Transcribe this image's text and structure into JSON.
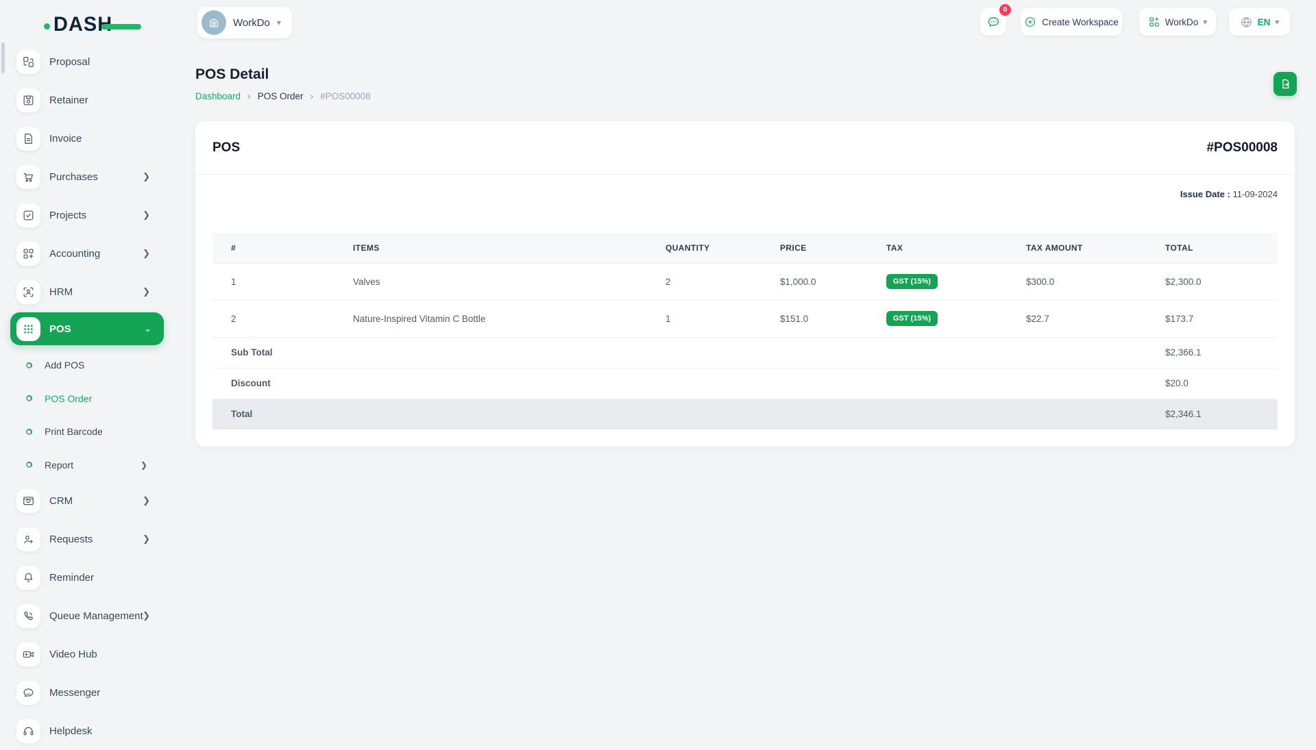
{
  "brand": {
    "logo": "DASH"
  },
  "topbar": {
    "workspace_name": "WorkDo",
    "chat_badge": "0",
    "create_workspace_label": "Create Workspace",
    "workspace_dropdown_label": "WorkDo",
    "language": "EN"
  },
  "page": {
    "title": "POS Detail",
    "breadcrumb": {
      "home": "Dashboard",
      "section": "POS Order",
      "current": "#POS00008"
    }
  },
  "sidebar": {
    "items": [
      {
        "label": "Proposal"
      },
      {
        "label": "Retainer"
      },
      {
        "label": "Invoice"
      },
      {
        "label": "Purchases"
      },
      {
        "label": "Projects"
      },
      {
        "label": "Accounting"
      },
      {
        "label": "HRM"
      },
      {
        "label": "CRM"
      },
      {
        "label": "Requests"
      },
      {
        "label": "Reminder"
      },
      {
        "label": "Queue Management"
      },
      {
        "label": "Video Hub"
      },
      {
        "label": "Messenger"
      },
      {
        "label": "Helpdesk"
      }
    ],
    "pos": {
      "label": "POS",
      "children": [
        {
          "label": "Add POS"
        },
        {
          "label": "POS Order"
        },
        {
          "label": "Print Barcode"
        },
        {
          "label": "Report"
        }
      ]
    }
  },
  "card": {
    "title": "POS",
    "number": "#POS00008",
    "issue_date_label": "Issue Date :",
    "issue_date_value": "11-09-2024"
  },
  "table": {
    "columns": [
      "#",
      "ITEMS",
      "QUANTITY",
      "PRICE",
      "TAX",
      "TAX AMOUNT",
      "TOTAL"
    ],
    "rows": [
      {
        "index": "1",
        "item": "Valves",
        "quantity": "2",
        "price": "$1,000.0",
        "tax": "GST (15%)",
        "tax_amount": "$300.0",
        "total": "$2,300.0"
      },
      {
        "index": "2",
        "item": "Nature-Inspired Vitamin C Bottle",
        "quantity": "1",
        "price": "$151.0",
        "tax": "GST (15%)",
        "tax_amount": "$22.7",
        "total": "$173.7"
      }
    ],
    "summary": {
      "subtotal_label": "Sub Total",
      "subtotal_value": "$2,366.1",
      "discount_label": "Discount",
      "discount_value": "$20.0",
      "total_label": "Total",
      "total_value": "$2,346.1"
    }
  },
  "colors": {
    "primary": "#15a356",
    "link": "#1aa762",
    "badge_red": "#fb3b5c",
    "navy": "#0e2437"
  }
}
